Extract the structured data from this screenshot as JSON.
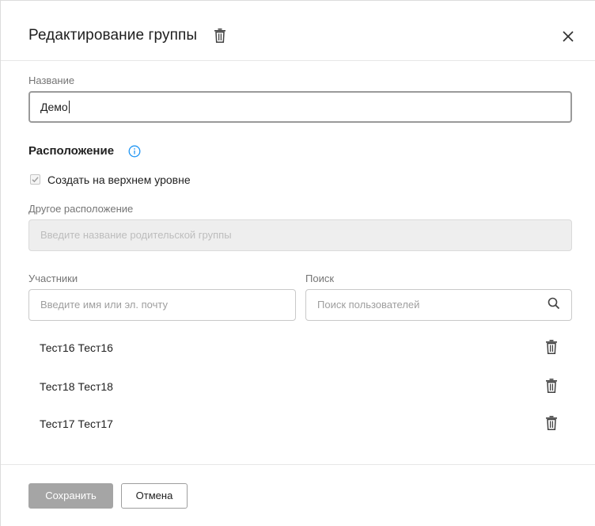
{
  "dialog": {
    "title": "Редактирование группы",
    "name_label": "Название",
    "name_value": "Демо",
    "location_title": "Расположение",
    "top_level_checkbox_label": "Создать на верхнем уровне",
    "top_level_checked": true,
    "other_location_label": "Другое расположение",
    "other_location_placeholder": "Введите название родительской группы",
    "participants_label": "Участники",
    "participants_placeholder": "Введите имя или эл. почту",
    "search_label": "Поиск",
    "search_placeholder": "Поиск пользователей",
    "members": [
      {
        "name": "Тест16 Тест16"
      },
      {
        "name": "Тест18 Тест18"
      },
      {
        "name": "Тест17 Тест17"
      }
    ],
    "save_label": "Сохранить",
    "cancel_label": "Отмена"
  },
  "colors": {
    "accent_info": "#2196f3",
    "save_disabled_bg": "#a5a5a5",
    "disabled_field_bg": "#eeeeee"
  },
  "icons": [
    "trash-icon",
    "close-icon",
    "info-icon",
    "checkmark-icon",
    "search-icon"
  ]
}
